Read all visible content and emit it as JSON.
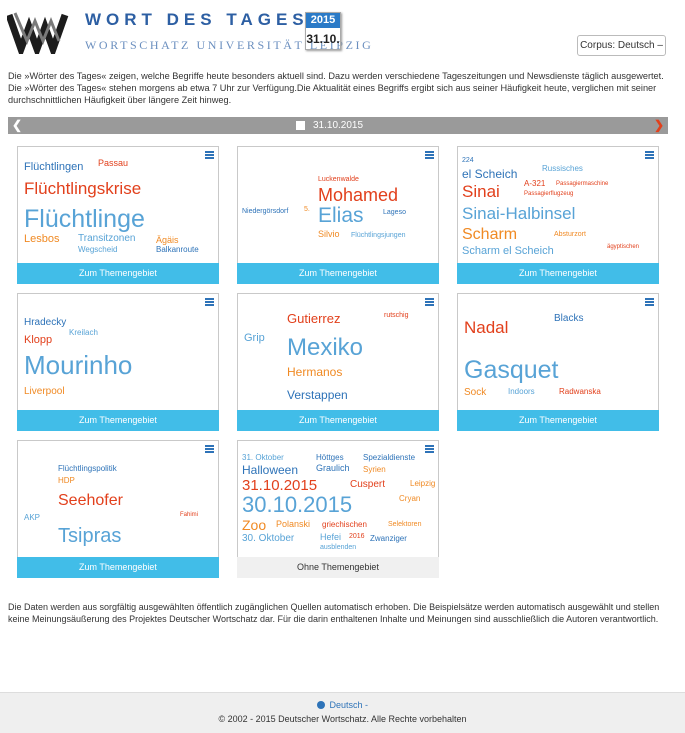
{
  "header": {
    "logo_title": "WORT DES TAGES",
    "logo_subtitle": "WORTSCHATZ UNIVERSITÄT LEIPZIG",
    "calendar_year": "2015",
    "calendar_day": "31.10.",
    "corpus_button": "Corpus: Deutsch",
    "corpus_caret": "–"
  },
  "intro": "Die »Wörter des Tages« zeigen, welche Begriffe heute besonders aktuell sind. Dazu werden verschiedene Tageszeitungen und Newsdienste täglich ausgewertet. Die »Wörter des Tages« stehen morgens ab etwa 7 Uhr zur Verfügung.Die Aktualität eines Begriffs ergibt sich aus seiner Häufigkeit heute, verglichen mit seiner durchschnittlichen Häufigkeit über längere Zeit hinweg.",
  "datebar": {
    "date": "31.10.2015",
    "prev_icon": "chevron-left-icon",
    "next_icon": "chevron-right-icon",
    "calendar_icon": "calendar-icon"
  },
  "button_label": "Zum Themengebiet",
  "no_topic_label": "Ohne Themengebiet",
  "colors": {
    "blue": "#2e73b8",
    "light_blue": "#58a3d6",
    "red": "#e2401c",
    "orange": "#f08a24",
    "button": "#41bde8",
    "datebar": "#9a9a9a"
  },
  "cards": [
    {
      "words": [
        "Flüchtlingen",
        "Passau",
        "Flüchtlingskrise",
        "Flüchtlinge",
        "Lesbos",
        "Transitzonen",
        "Ägäis",
        "Wegscheid",
        "Balkanroute"
      ]
    },
    {
      "words": [
        "Luckenwalde",
        "Mohamed",
        "Niedergörsdorf",
        "5.",
        "Elias",
        "Lageso",
        "Silvio",
        "Flüchtlingsjungen"
      ]
    },
    {
      "words": [
        "224",
        "Russisches",
        "el Scheich",
        "A-321",
        "Passagiermaschine",
        "Sinai",
        "Passagierflugzeug",
        "Sinai-Halbinsel",
        "Absturzort",
        "Scharm",
        "ägyptischen",
        "Scharm el Scheich"
      ]
    },
    {
      "words": [
        "Hradecky",
        "Kreilach",
        "Klopp",
        "Mourinho",
        "Liverpool"
      ]
    },
    {
      "words": [
        "Gutierrez",
        "rutschig",
        "Grip",
        "Mexiko",
        "Hermanos",
        "Verstappen"
      ]
    },
    {
      "words": [
        "Blacks",
        "Nadal",
        "Gasquet",
        "Sock",
        "Indoors",
        "Radwanska"
      ]
    },
    {
      "words": [
        "Flüchtlingspolitik",
        "HDP",
        "Seehofer",
        "AKP",
        "Fahimi",
        "Tsipras"
      ]
    },
    {
      "words": [
        "31. Oktober",
        "Höttges",
        "Spezialdienste",
        "Halloween",
        "Graulich",
        "Syrien",
        "31.10.2015",
        "Cuspert",
        "Leipzig",
        "30.10.2015",
        "Cryan",
        "Zoo",
        "Polanski",
        "griechischen",
        "Selektoren",
        "30. Oktober",
        "Hefei",
        "2016",
        "Zwanziger",
        "ausblenden"
      ]
    }
  ],
  "footer": {
    "disclaimer": "Die Daten werden aus sorgfältig ausgewählten öffentlich zugänglichen Quellen automatisch erhoben. Die Beispielsätze werden automatisch ausgewählt und stellen keine Meinungsäußerung des Projektes Deutscher Wortschatz dar. Für die darin enthaltenen Inhalte und Meinungen sind ausschließlich die Autoren verantwortlich.",
    "language": "Deutsch",
    "language_caret": "-",
    "copyright": "© 2002 - 2015 Deutscher Wortschatz. Alle Rechte vorbehalten"
  }
}
